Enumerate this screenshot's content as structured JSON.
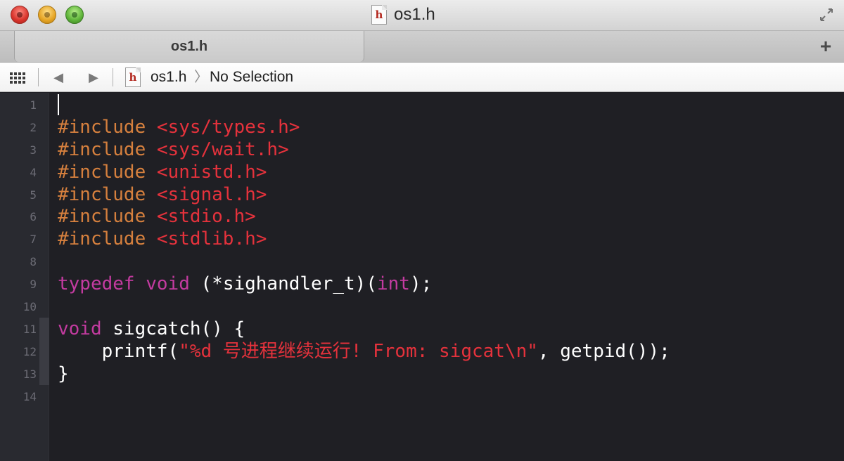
{
  "window": {
    "title": "os1.h",
    "file_icon_glyph": "h"
  },
  "tabs": [
    {
      "label": "os1.h"
    }
  ],
  "tabbar": {
    "add_label": "+"
  },
  "jumpbar": {
    "file": "os1.h",
    "chevron": "〉",
    "selection": "No Selection",
    "back_glyph": "◀",
    "forward_glyph": "▶"
  },
  "editor": {
    "line_numbers": [
      "1",
      "2",
      "3",
      "4",
      "5",
      "6",
      "7",
      "8",
      "9",
      "10",
      "11",
      "12",
      "13",
      "14"
    ],
    "colors": {
      "background": "#1f1f24",
      "preprocessor": "#d6803e",
      "include_path": "#e5323c",
      "keyword": "#c33ba0",
      "string": "#e5323c",
      "plain": "#ffffff"
    },
    "lines": [
      [],
      [
        {
          "t": "pre",
          "s": "#include "
        },
        {
          "t": "inc",
          "s": "<sys/types.h>"
        }
      ],
      [
        {
          "t": "pre",
          "s": "#include "
        },
        {
          "t": "inc",
          "s": "<sys/wait.h>"
        }
      ],
      [
        {
          "t": "pre",
          "s": "#include "
        },
        {
          "t": "inc",
          "s": "<unistd.h>"
        }
      ],
      [
        {
          "t": "pre",
          "s": "#include "
        },
        {
          "t": "inc",
          "s": "<signal.h>"
        }
      ],
      [
        {
          "t": "pre",
          "s": "#include "
        },
        {
          "t": "inc",
          "s": "<stdio.h>"
        }
      ],
      [
        {
          "t": "pre",
          "s": "#include "
        },
        {
          "t": "inc",
          "s": "<stdlib.h>"
        }
      ],
      [],
      [
        {
          "t": "kw",
          "s": "typedef"
        },
        {
          "t": "plain",
          "s": " "
        },
        {
          "t": "kw",
          "s": "void"
        },
        {
          "t": "plain",
          "s": " (*sighandler_t)("
        },
        {
          "t": "kw",
          "s": "int"
        },
        {
          "t": "plain",
          "s": ");"
        }
      ],
      [],
      [
        {
          "t": "kw",
          "s": "void"
        },
        {
          "t": "plain",
          "s": " sigcatch() {"
        }
      ],
      [
        {
          "t": "plain",
          "s": "    printf("
        },
        {
          "t": "str",
          "s": "\"%d 号进程继续运行! From: sigcat\\n\""
        },
        {
          "t": "plain",
          "s": ", getpid());"
        }
      ],
      [
        {
          "t": "plain",
          "s": "}"
        }
      ],
      []
    ]
  }
}
